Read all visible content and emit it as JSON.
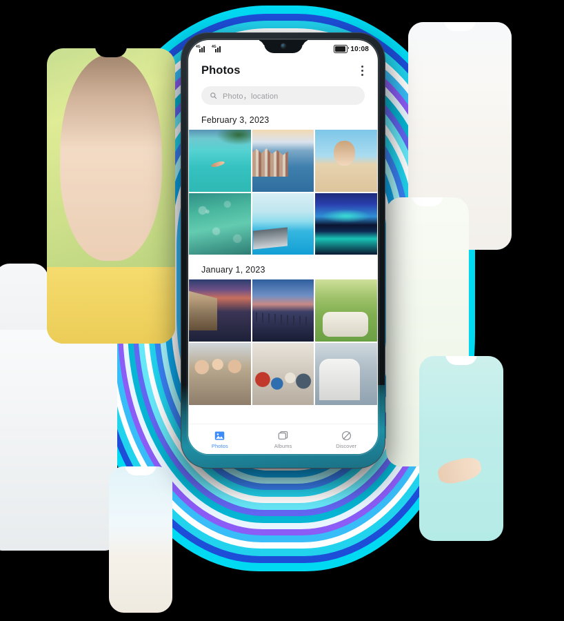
{
  "device": {
    "statusbar": {
      "sim1_label": "4G",
      "sim2_label": "4G",
      "time": "10:08",
      "battery_icon": "battery-icon",
      "signal_icon": "signal-bars-icon"
    }
  },
  "app": {
    "title": "Photos",
    "overflow_icon": "kebab-menu-icon",
    "search": {
      "placeholder": "Photo，location",
      "icon": "search-icon"
    },
    "sections": [
      {
        "date": "February 3, 2023",
        "photos": [
          {
            "name": "photo-lagoon-snorkeler",
            "style": "p-lagoon"
          },
          {
            "name": "photo-coastal-city-aerial",
            "style": "p-city"
          },
          {
            "name": "photo-toddler-on-beach",
            "style": "p-child"
          },
          {
            "name": "photo-coral-reef-water",
            "style": "p-reef"
          },
          {
            "name": "photo-infinity-pool-loungers",
            "style": "p-pool"
          },
          {
            "name": "photo-aurora-over-sea",
            "style": "p-aurora"
          }
        ]
      },
      {
        "date": "January 1, 2023",
        "photos": [
          {
            "name": "photo-venice-grand-canal-dusk",
            "style": "p-venice"
          },
          {
            "name": "photo-pier-at-twilight",
            "style": "p-pier"
          },
          {
            "name": "photo-couple-heart-hands-picnic",
            "style": "p-picnic"
          },
          {
            "name": "photo-women-with-sunglasses",
            "style": "p-girls"
          },
          {
            "name": "photo-friends-group-selfie",
            "style": "p-friends"
          },
          {
            "name": "photo-couple-canal-selfie",
            "style": "p-couple"
          }
        ]
      }
    ],
    "tabs": [
      {
        "label": "Photos",
        "icon": "image-icon",
        "active": true
      },
      {
        "label": "Albums",
        "icon": "albums-icon",
        "active": false
      },
      {
        "label": "Discover",
        "icon": "globe-icon",
        "active": false
      }
    ]
  },
  "decor": {
    "glow_colors": [
      "#00e5ff",
      "#22d3ee",
      "#3b82f6",
      "#6366f1",
      "#8b5cf6",
      "#ffffff",
      "#0ea5e9"
    ],
    "accent_color": "#3d8bf8",
    "background_color": "#000000",
    "cards": [
      {
        "name": "decor-card-portrait-woman",
        "style": "p-portrait"
      },
      {
        "name": "decor-card-venice-faded",
        "style": "p-venice2"
      },
      {
        "name": "decor-card-hammock-faded",
        "style": "p-hammock"
      },
      {
        "name": "decor-card-swimmer-turquoise",
        "style": "p-swim"
      },
      {
        "name": "decor-card-couple-laughing",
        "style": "p-couple2"
      },
      {
        "name": "decor-card-blank-white",
        "style": "p-white"
      },
      {
        "name": "decor-card-laughing-girl",
        "style": "p-girl2"
      }
    ]
  }
}
